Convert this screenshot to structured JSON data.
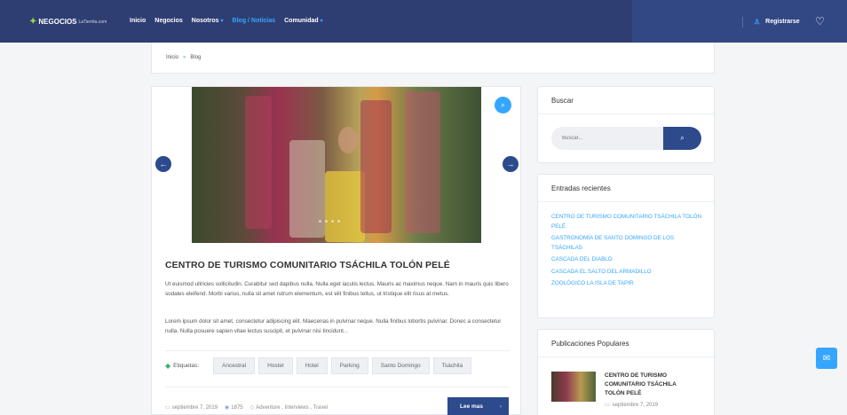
{
  "header": {
    "logo_main": "NEGOCIOS",
    "logo_sub": "LaTierrita.com",
    "nav": [
      {
        "label": "Inicio"
      },
      {
        "label": "Negocios"
      },
      {
        "label": "Nosotros"
      },
      {
        "label": "Blog / Noticias"
      },
      {
        "label": "Comunidad"
      }
    ],
    "register_label": "Registrarse"
  },
  "breadcrumb": {
    "home": "Inicio",
    "separator": "»",
    "current": "Blog"
  },
  "post": {
    "title": "CENTRO DE TURISMO COMUNITARIO TSÁCHILA TOLÓN PELÉ",
    "paragraph1": "Ut euismod ultricies sollicitudin. Curabitur sed dapibus nulla. Nulla eget iaculis lectus. Mauris ac maximus neque. Nam in mauris quis libero sodales eleifend. Morbi varius, nulla sit amet rutrum elementum, est elit finibus tellus, ut tristique elit risus at metus.",
    "paragraph2": "Lorem ipsum dolor sit amet, consectetur adipiscing elit. Maecenas in pulvinar neque. Nulla finibus lobortis pulvinar. Donec a consectetur nulla. Nulla posuere sapien vitae lectus suscipit, et pulvinar nisi tincidunt...",
    "tags_label": "Etiquetas:",
    "tags": [
      "Ancestral",
      "Hostel",
      "Hotel",
      "Parking",
      "Santo Domingo",
      "Tsáchila"
    ],
    "date": "septiembre 7, 2019",
    "views": "1875",
    "categories": "Adventure , Interviews , Travel",
    "read_more": "Lee mas"
  },
  "sidebar": {
    "search": {
      "title": "Buscar",
      "placeholder": "Buscar..."
    },
    "recent": {
      "title": "Entradas recientes",
      "items": [
        "CENTRO DE TURISMO COMUNITARIO TSÁCHILA TOLÓN PELÉ",
        "GASTRONOMÍA DE SANTO DOMINGO DE LOS TSÁCHILAS",
        "CASCADA DEL DIABLO",
        "CASCADA EL SALTO DEL ARMADILLO",
        "ZOOLÓGICO LA ISLA DE TAPIR"
      ]
    },
    "popular": {
      "title": "Publicaciones Populares",
      "item_title": "CENTRO DE TURISMO COMUNITARIO TSÁCHILA TOLÓN PELÉ",
      "item_date": "septiembre 7, 2019"
    }
  },
  "colors": {
    "navy": "#2e3e72",
    "accent": "#35a6ff",
    "button": "#2d4a8c"
  },
  "icons": {
    "search": "search-icon",
    "user": "user-icon",
    "chat": "chat-icon",
    "calendar": "calendar-icon",
    "eye": "eye-icon",
    "tag": "tag-icon"
  }
}
